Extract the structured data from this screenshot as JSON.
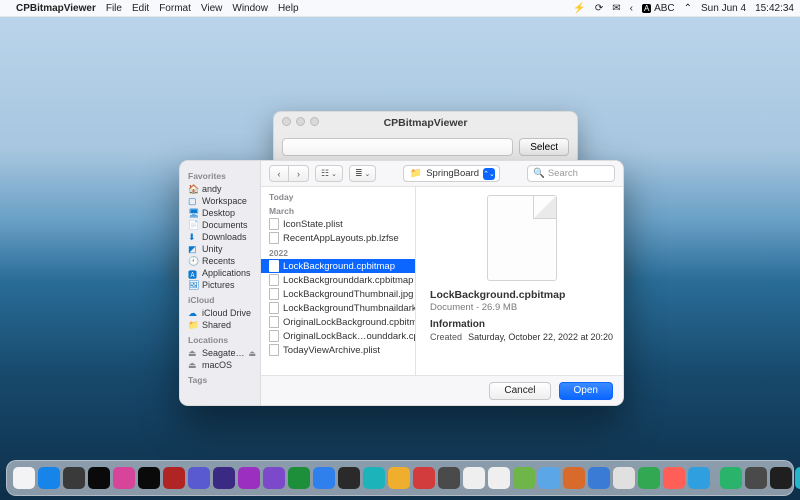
{
  "menubar": {
    "app_name": "CPBitmapViewer",
    "items": [
      "File",
      "Edit",
      "Format",
      "View",
      "Window",
      "Help"
    ],
    "status": {
      "lang": "ABC",
      "date": "Sun Jun 4",
      "time": "15:42:34"
    }
  },
  "app_window": {
    "title": "CPBitmapViewer",
    "select_label": "Select"
  },
  "open_panel": {
    "sidebar": {
      "favorites_label": "Favorites",
      "favorites": [
        {
          "icon": "home",
          "label": "andy"
        },
        {
          "icon": "square",
          "label": "Workspace"
        },
        {
          "icon": "desktop",
          "label": "Desktop"
        },
        {
          "icon": "doc",
          "label": "Documents"
        },
        {
          "icon": "down",
          "label": "Downloads"
        },
        {
          "icon": "cube",
          "label": "Unity"
        },
        {
          "icon": "clock",
          "label": "Recents"
        },
        {
          "icon": "app",
          "label": "Applications"
        },
        {
          "icon": "pic",
          "label": "Pictures"
        }
      ],
      "icloud_label": "iCloud",
      "icloud": [
        {
          "icon": "cloud",
          "label": "iCloud Drive"
        },
        {
          "icon": "folder",
          "label": "Shared"
        }
      ],
      "locations_label": "Locations",
      "locations": [
        {
          "icon": "disk",
          "label": "Seagate…",
          "eject": true
        },
        {
          "icon": "disk",
          "label": "macOS"
        }
      ],
      "tags_label": "Tags"
    },
    "toolbar": {
      "location": "SpringBoard",
      "search_placeholder": "Search"
    },
    "list": {
      "groups": [
        {
          "label": "Today",
          "rows": []
        },
        {
          "label": "March",
          "rows": [
            {
              "name": "IconState.plist"
            },
            {
              "name": "RecentAppLayouts.pb.lzfse"
            }
          ]
        },
        {
          "label": "2022",
          "rows": [
            {
              "name": "LockBackground.cpbitmap",
              "selected": true
            },
            {
              "name": "LockBackgrounddark.cpbitmap"
            },
            {
              "name": "LockBackgroundThumbnail.jpg"
            },
            {
              "name": "LockBackgroundThumbnaildark.jpg"
            },
            {
              "name": "OriginalLockBackground.cpbitmap"
            },
            {
              "name": "OriginalLockBack…ounddark.cpbitmap"
            },
            {
              "name": "TodayViewArchive.plist"
            }
          ]
        }
      ]
    },
    "preview": {
      "filename": "LockBackground.cpbitmap",
      "kind_size": "Document - 26.9 MB",
      "info_label": "Information",
      "created_label": "Created",
      "created_value": "Saturday, October 22, 2022 at 20:20"
    },
    "footer": {
      "cancel": "Cancel",
      "open": "Open"
    }
  },
  "dock_colors": [
    "#f3f3f5",
    "#1784ea",
    "#3a3a3a",
    "#0a0a0a",
    "#d64599",
    "#0a0a0a",
    "#b02424",
    "#5a5ad0",
    "#3b2a84",
    "#9a2fc0",
    "#7b49c9",
    "#1d8f3a",
    "#2f80ed",
    "#2a2a2a",
    "#1db3bb",
    "#efae2e",
    "#d23c3c",
    "#4a4a4a",
    "#efefef",
    "#efefef",
    "#6fb64a",
    "#5aa6e6",
    "#d86b2c",
    "#3a7bd5",
    "#e0e0e0",
    "#32a852",
    "#ff5f57",
    "#2f9fe0",
    "#29b36b",
    "#4a4a4a",
    "#1f1f1f",
    "#24b6c8",
    "#1f1f1f"
  ]
}
